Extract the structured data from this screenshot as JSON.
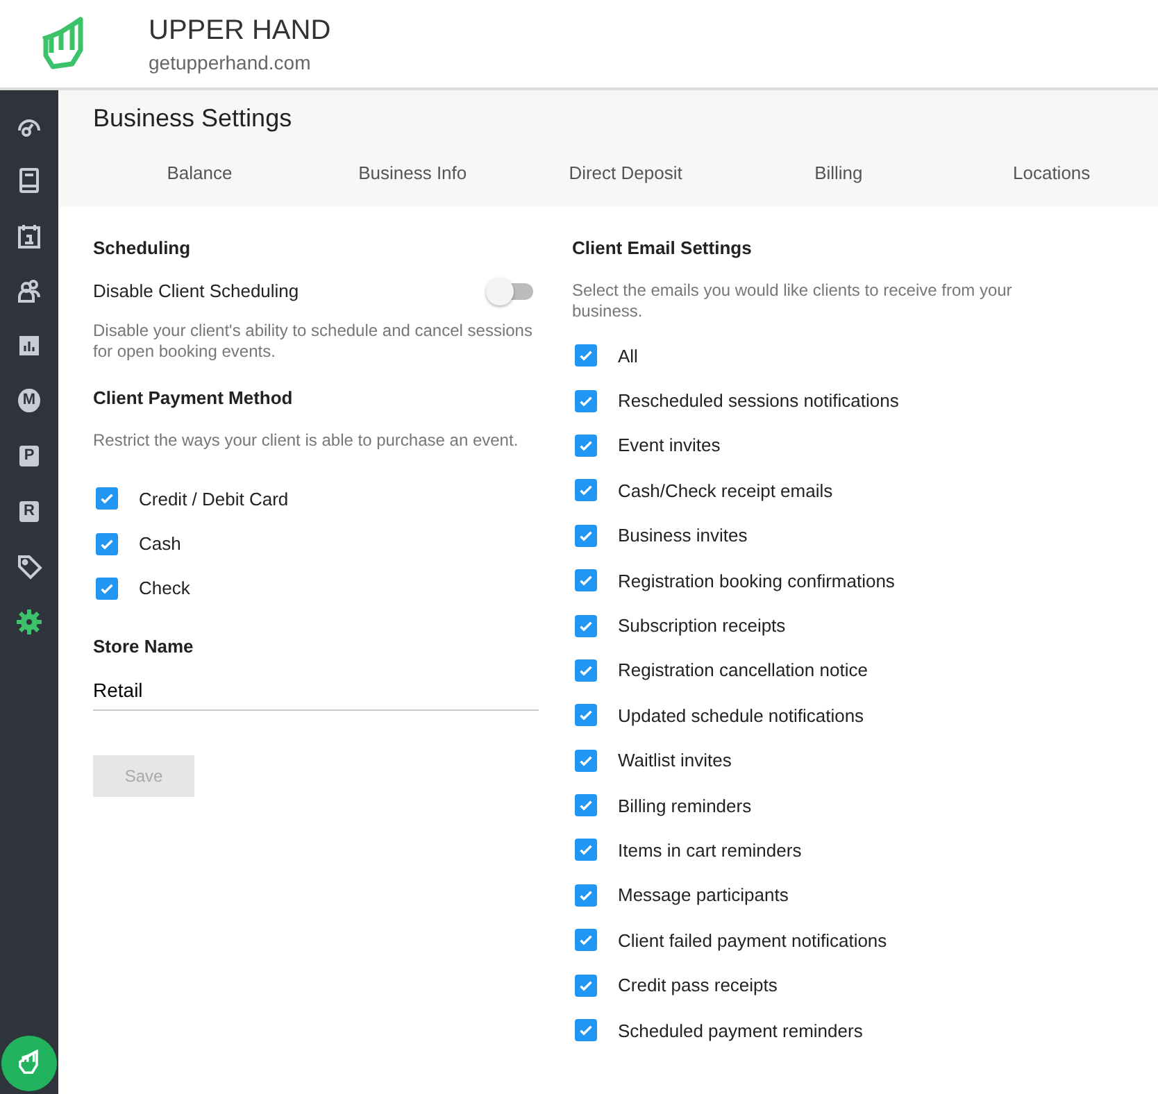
{
  "header": {
    "brand": "UPPER HAND",
    "site": "getupperhand.com"
  },
  "sidebar": {
    "items": [
      {
        "selected": false
      },
      {
        "selected": false
      },
      {
        "selected": false
      },
      {
        "selected": false
      },
      {
        "selected": false
      },
      {
        "glyph": "M",
        "selected": false
      },
      {
        "glyph": "P",
        "selected": false
      },
      {
        "glyph": "R",
        "selected": false
      },
      {
        "selected": false
      },
      {
        "selected": true
      }
    ]
  },
  "page": {
    "title": "Business Settings"
  },
  "tabs": [
    {
      "label": "Balance",
      "selected": false
    },
    {
      "label": "Business Info",
      "selected": false
    },
    {
      "label": "Direct Deposit",
      "selected": false
    },
    {
      "label": "Billing",
      "selected": false
    },
    {
      "label": "Locations",
      "selected": false
    }
  ],
  "scheduling": {
    "heading": "Scheduling",
    "toggle_label": "Disable Client Scheduling",
    "on": false,
    "help": "Disable your client's ability to schedule and cancel sessions for open booking events."
  },
  "payment": {
    "heading": "Client Payment Method",
    "help": "Restrict the ways your client is able to purchase an event.",
    "options": [
      {
        "label": "Credit / Debit Card",
        "checked": true
      },
      {
        "label": "Cash",
        "checked": true
      },
      {
        "label": "Check",
        "checked": true
      }
    ]
  },
  "store": {
    "heading": "Store Name",
    "value": "Retail"
  },
  "save": {
    "label": "Save",
    "disabled": true
  },
  "email": {
    "heading": "Client Email Settings",
    "help": "Select the emails you would like clients to receive from your business.",
    "options": [
      {
        "label": "All",
        "checked": true
      },
      {
        "label": "Rescheduled sessions notifications",
        "checked": true
      },
      {
        "label": "Event invites",
        "checked": true
      },
      {
        "label": "Cash/Check receipt emails",
        "checked": true
      },
      {
        "label": "Business invites",
        "checked": true
      },
      {
        "label": "Registration booking confirmations",
        "checked": true
      },
      {
        "label": "Subscription receipts",
        "checked": true
      },
      {
        "label": "Registration cancellation notice",
        "checked": true
      },
      {
        "label": "Updated schedule notifications",
        "checked": true
      },
      {
        "label": "Waitlist invites",
        "checked": true
      },
      {
        "label": "Billing reminders",
        "checked": true
      },
      {
        "label": "Items in cart reminders",
        "checked": true
      },
      {
        "label": "Message participants",
        "checked": true
      },
      {
        "label": "Client failed payment notifications",
        "checked": true
      },
      {
        "label": "Credit pass receipts",
        "checked": true
      },
      {
        "label": "Scheduled payment reminders",
        "checked": true
      }
    ]
  }
}
